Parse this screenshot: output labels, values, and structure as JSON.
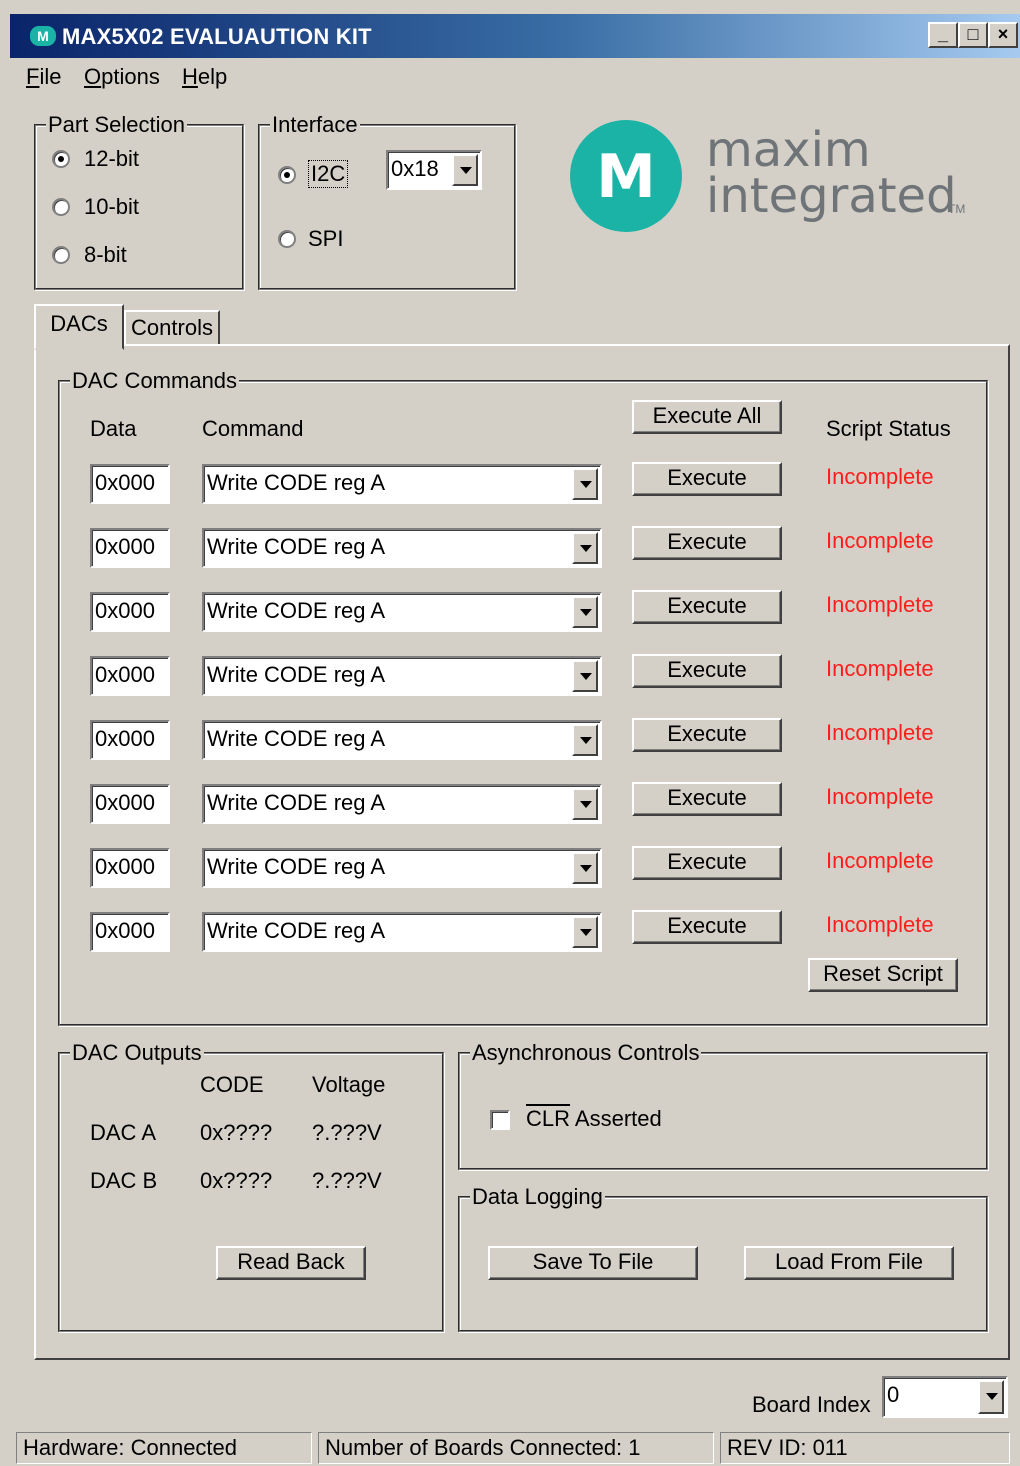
{
  "window": {
    "title": "MAX5X02 EVALUAUTION KIT",
    "app_icon": "maxim-logo-icon",
    "minimize": "_",
    "maximize": "□",
    "close": "×"
  },
  "menu": [
    "File",
    "Options",
    "Help"
  ],
  "part_selection": {
    "title": "Part Selection",
    "options": [
      "12-bit",
      "10-bit",
      "8-bit"
    ],
    "selected": "12-bit"
  },
  "interface": {
    "title": "Interface",
    "options": [
      "I2C",
      "SPI"
    ],
    "selected": "I2C",
    "address": "0x18"
  },
  "logo": {
    "line1": "maxim",
    "line2": "integrated",
    "tm": "TM",
    "mark": "M",
    "color": "#1bb3a6"
  },
  "tabs": [
    "DACs",
    "Controls"
  ],
  "dac_commands": {
    "title": "DAC Commands",
    "headers": {
      "data": "Data",
      "command": "Command",
      "script_status": "Script Status"
    },
    "execute_all": "Execute All",
    "execute": "Execute",
    "reset_script": "Reset Script",
    "rows": [
      {
        "data": "0x000",
        "command": "Write CODE reg A",
        "status": "Incomplete"
      },
      {
        "data": "0x000",
        "command": "Write CODE reg A",
        "status": "Incomplete"
      },
      {
        "data": "0x000",
        "command": "Write CODE reg A",
        "status": "Incomplete"
      },
      {
        "data": "0x000",
        "command": "Write CODE reg A",
        "status": "Incomplete"
      },
      {
        "data": "0x000",
        "command": "Write CODE reg A",
        "status": "Incomplete"
      },
      {
        "data": "0x000",
        "command": "Write CODE reg A",
        "status": "Incomplete"
      },
      {
        "data": "0x000",
        "command": "Write CODE reg A",
        "status": "Incomplete"
      },
      {
        "data": "0x000",
        "command": "Write CODE reg A",
        "status": "Incomplete"
      }
    ],
    "status_color": "#ff1c1c"
  },
  "dac_outputs": {
    "title": "DAC Outputs",
    "headers": {
      "code": "CODE",
      "voltage": "Voltage"
    },
    "rows": [
      {
        "name": "DAC A",
        "code": "0x????",
        "voltage": "?.???V"
      },
      {
        "name": "DAC B",
        "code": "0x????",
        "voltage": "?.???V"
      }
    ],
    "read_back": "Read Back"
  },
  "async_controls": {
    "title": "Asynchronous Controls",
    "clr_label": "CLR",
    "clr_suffix": " Asserted",
    "checked": false
  },
  "data_logging": {
    "title": "Data Logging",
    "save": "Save To File",
    "load": "Load From File"
  },
  "board_index": {
    "label": "Board Index",
    "value": "0"
  },
  "status_bar": {
    "hardware": "Hardware: Connected",
    "boards": "Number of Boards Connected: 1",
    "rev": "REV ID: 011"
  }
}
